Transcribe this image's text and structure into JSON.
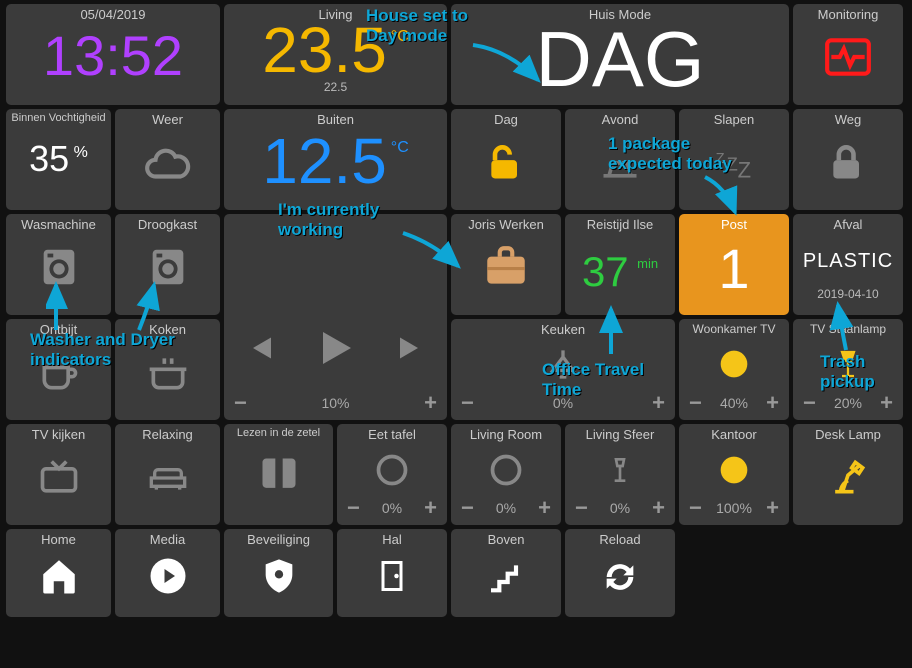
{
  "header": {
    "date": "05/04/2019",
    "clock": "13:52",
    "living_label": "Living",
    "living_temp": "23.5",
    "living_set": "22.5",
    "huis_mode_label": "Huis Mode",
    "huis_mode_value": "DAG",
    "monitoring_label": "Monitoring"
  },
  "row2": {
    "humidity_label": "Binnen Vochtigheid",
    "humidity_value": "35",
    "humidity_unit": "%",
    "weather_label": "Weer",
    "outside_label": "Buiten",
    "outside_value": "12.5",
    "outside_unit": "°C",
    "dag_label": "Dag",
    "avond_label": "Avond",
    "slapen_label": "Slapen",
    "weg_label": "Weg"
  },
  "row3": {
    "wasmachine_label": "Wasmachine",
    "droogkast_label": "Droogkast",
    "joris_label": "Joris Werken",
    "reistijd_label": "Reistijd Ilse",
    "reistijd_value": "37",
    "reistijd_unit": "min",
    "post_label": "Post",
    "post_value": "1",
    "afval_label": "Afval",
    "afval_type": "PLASTIC",
    "afval_date": "2019-04-10"
  },
  "row4": {
    "ontbijt": "Ontbijt",
    "koken": "Koken",
    "media_vol": "10%",
    "keuken_label": "Keuken",
    "keuken_pct": "0%",
    "woonkamer_label": "Woonkamer TV",
    "woonkamer_pct": "40%",
    "staanlamp_label": "TV Staanlamp",
    "staanlamp_pct": "20%"
  },
  "row5": {
    "tvkijken": "TV kijken",
    "relaxing": "Relaxing",
    "lezen": "Lezen in de zetel",
    "eettafel_label": "Eet tafel",
    "eettafel_pct": "0%",
    "livingroom_label": "Living Room",
    "livingroom_pct": "0%",
    "livingsfeer_label": "Living Sfeer",
    "livingsfeer_pct": "0%",
    "kantoor_label": "Kantoor",
    "kantoor_pct": "100%",
    "desklamp_label": "Desk Lamp"
  },
  "nav": {
    "home": "Home",
    "media": "Media",
    "beveiliging": "Beveiliging",
    "hal": "Hal",
    "boven": "Boven",
    "reload": "Reload"
  },
  "annot": {
    "a1": "House set to\nDay mode",
    "a2": "1 package\nexpected today",
    "a3": "I'm currently\nworking",
    "a4": "Washer and Dryer\nindicators",
    "a5": "Office Travel\nTime",
    "a6": "Trash\npickup"
  }
}
